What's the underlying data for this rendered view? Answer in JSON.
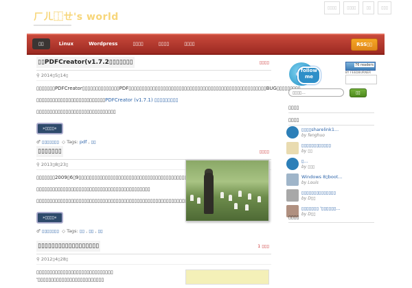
{
  "site": {
    "title": "ㄏㄦ⿰ㄝ's world",
    "description": "━━━━━━━━━━━━━━"
  },
  "top_links": [
    "▯▯▯▯",
    "▯▯▯▯",
    "▯▯",
    "▯▯▯"
  ],
  "nav": {
    "items": [
      "▯▯",
      "Linux",
      "Wordpress",
      "▯▯▯▯",
      "▯▯▯▯",
      "▯▯▯▯"
    ],
    "rss": "RSS▯▯"
  },
  "posts": [
    {
      "title": "▯▯PDFCreator(v1.7.2▯▯▯▯▯▯▯",
      "comments": "▯▯▯▯",
      "date": "2014▯5▯14▯",
      "paragraphs": [
        "▯▯▯▯▯▯▯PDFCreator▯▯▯▯▯▯▯▯▯▯▯▯▯▯PDF▯▯▯▯▯▯▯▯▯▯▯▯▯▯▯▯▯▯▯▯▯▯▯▯▯▯▯▯▯▯▯▯▯▯▯▯▯▯▯▯▯▯▯▯▯▯▯▯▯▯▯▯BUG▯▯▯▯▯▯▯▯▯",
        "▯▯▯▯▯▯▯▯▯▯▯▯▯▯▯▯▯▯▯▯▯▯▯▯▯▯",
        "▯▯▯▯▯▯▯▯▯▯▯▯▯▯▯▯▯▯▯▯▯▯▯▯▯▯▯▯▯▯"
      ],
      "link": "PDFCreator (v1.7.1) ▯▯▯▯▯▯▯▯▯",
      "more": "»▯▯▯▯«",
      "author": "▯▯▯▯▯▯▯",
      "tags_label": "Tags:",
      "tags": [
        "pdf",
        "▯▯"
      ]
    },
    {
      "title": "▯▯▯▯▯▯▯",
      "comments": "▯▯▯▯",
      "date": "2013▯8▯23▯",
      "paragraphs": [
        "▯▯▯▯▯▯▯2009▯6▯9▯▯▯▯▯▯▯▯▯▯▯▯▯▯▯▯▯▯▯▯▯▯▯▯▯▯▯▯▯▯▯▯▯▯▯▯▯▯▯▯▯▯▯▯▯▯▯▯▯▯▯▯▯▯▯▯▯▯▯▯▯",
        "▯▯▯▯▯▯▯▯▯▯▯▯▯▯▯▯▯▯▯▯▯▯▯▯▯▯▯▯▯▯▯▯▯▯▯▯▯▯▯▯▯▯▯",
        "▯▯▯▯▯▯▯▯▯▯▯▯▯▯▯▯▯▯▯▯▯▯▯▯▯▯▯▯▯▯▯▯▯▯▯▯▯▯▯▯▯▯▯▯▯▯▯▯▯▯▯▯▯▯▯▯▯▯▯▯"
      ],
      "more": "»▯▯▯▯«",
      "author": "▯▯▯▯▯▯▯",
      "tags_label": "Tags:",
      "tags": [
        "▯▯",
        "▯▯",
        "▯▯"
      ]
    },
    {
      "title": "▯▯▯▯▯▯▯▯▯▯▯▯▯▯▯▯▯▯",
      "comments": "1 ▯▯▯",
      "date": "2012▯4▯28▯",
      "paragraphs": [
        "▯▯▯▯▯▯▯▯▯▯▯▯▯▯▯▯▯▯▯▯▯▯▯▯▯▯▯▯▯ '▯▯▯▯▯▯▯▯▯▯▯▯▯▯▯▯▯▯▯▯▯▯▯▯▯"
      ]
    }
  ],
  "sidebar": {
    "feed_count": "76 readers",
    "feed_label": "BY FEEDBURNER",
    "follow_text": "follow me",
    "search_placeholder": "▯▯▯▯...",
    "search_button": "▯▯",
    "widgets": {
      "w1": "▯▯▯▯",
      "w2": "▯▯▯▯",
      "w3": "▯▯▯▯"
    },
    "recent": [
      {
        "text": "▯▯▯▯sharelink1...",
        "by": "by fenghuo",
        "color": "#2c7fb8"
      },
      {
        "text": "▯▯▯▯▯▯▯▯▯▯▯▯",
        "by": "by ▯▯",
        "color": "#d9c9a0"
      },
      {
        "text": "▯...",
        "by": "by ▯▯▯",
        "color": "#2c7fb8"
      },
      {
        "text": "Windows 8▯boot...",
        "by": "by Louis",
        "color": "#9fb5c9"
      },
      {
        "text": "▯▯▯▯▯▯▯▯▯▯▯▯▯▯",
        "by": "by D▯▯",
        "color": "#a8a8a8"
      },
      {
        "text": "▯▯▯▯▯▯▯ '▯▯▯▯▯▯...",
        "by": "by D▯▯",
        "color": "#b09080"
      }
    ]
  }
}
